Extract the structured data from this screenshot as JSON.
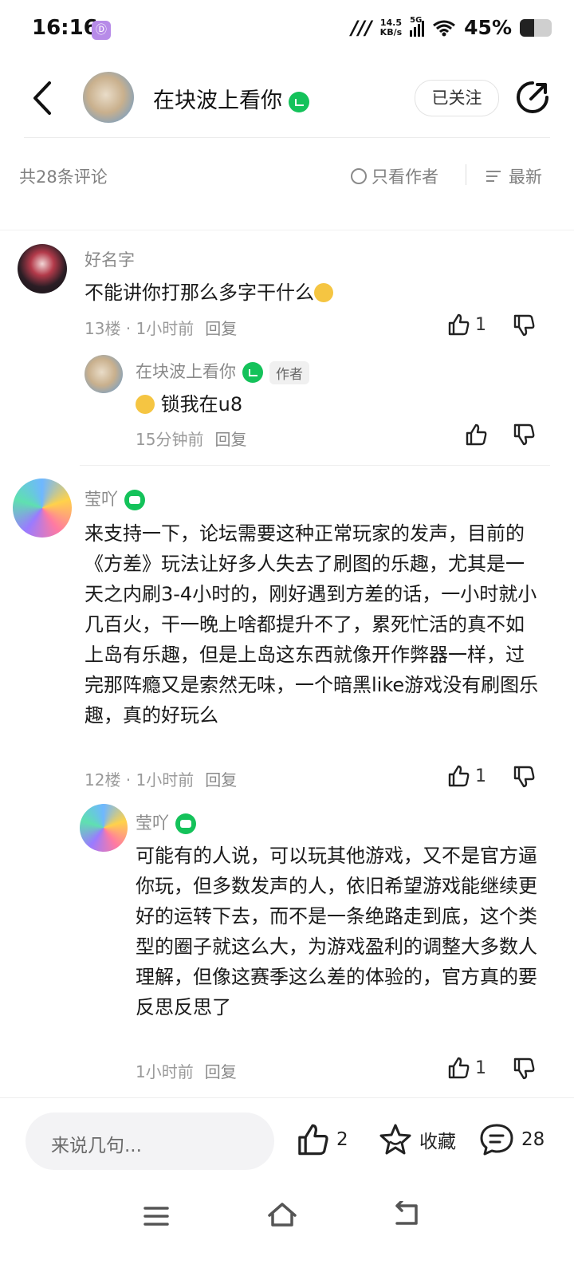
{
  "status_bar": {
    "time": "16:16",
    "app_badge": "Ⓓ",
    "net_speed_value": "14.5",
    "net_speed_unit": "KB/s",
    "signal": "5G",
    "battery": "45%",
    "battery_level": 0.45
  },
  "header": {
    "author_name": "在块波上看你",
    "follow_label": "已关注"
  },
  "filter": {
    "total_comments": "共28条评论",
    "only_author_label": "只看作者",
    "sort_label": "最新"
  },
  "comments": [
    {
      "user": "好名字",
      "text": "不能讲你打那么多字干什么",
      "floor": "13楼",
      "time": "1小时前",
      "reply_label": "回复",
      "likes": "1",
      "replies": [
        {
          "user": "在块波上看你",
          "tag": "作者",
          "text": "锁我在u8",
          "time": "15分钟前",
          "reply_label": "回复"
        }
      ]
    },
    {
      "user": "莹吖",
      "text": "来支持一下，论坛需要这种正常玩家的发声，目前的《方差》玩法让好多人失去了刷图的乐趣，尤其是一天之内刷3-4小时的，刚好遇到方差的话，一小时就小几百火，干一晚上啥都提升不了，累死忙活的真不如上岛有乐趣，但是上岛这东西就像开作弊器一样，过完那阵瘾又是索然无味，一个暗黑like游戏没有刷图乐趣，真的好玩么",
      "floor": "12楼",
      "time": "1小时前",
      "reply_label": "回复",
      "likes": "1",
      "replies": [
        {
          "user": "莹吖",
          "text": "可能有的人说，可以玩其他游戏，又不是官方逼你玩，但多数发声的人，依旧希望游戏能继续更好的运转下去，而不是一条绝路走到底，这个类型的圈子就这么大，为游戏盈利的调整大多数人理解，但像这赛季这么差的体验的，官方真的要反思反思了",
          "time": "1小时前",
          "reply_label": "回复",
          "likes": "1"
        }
      ]
    }
  ],
  "bottom_bar": {
    "input_placeholder": "来说几句...",
    "like_count": "2",
    "favorite_label": "收藏",
    "comment_count": "28"
  },
  "icons": {
    "back": "back-arrow-icon",
    "share": "share-icon",
    "like": "thumbs-up-icon",
    "dislike": "thumbs-down-icon",
    "favorite": "star-icon",
    "comment": "comment-bubble-icon",
    "nav_menu": "menu-icon",
    "nav_home": "home-icon",
    "nav_back": "back-gesture-icon"
  },
  "colors": {
    "verified_green": "#14c25a",
    "text_primary": "#1a1a1a",
    "text_secondary": "#8a8a8a"
  }
}
